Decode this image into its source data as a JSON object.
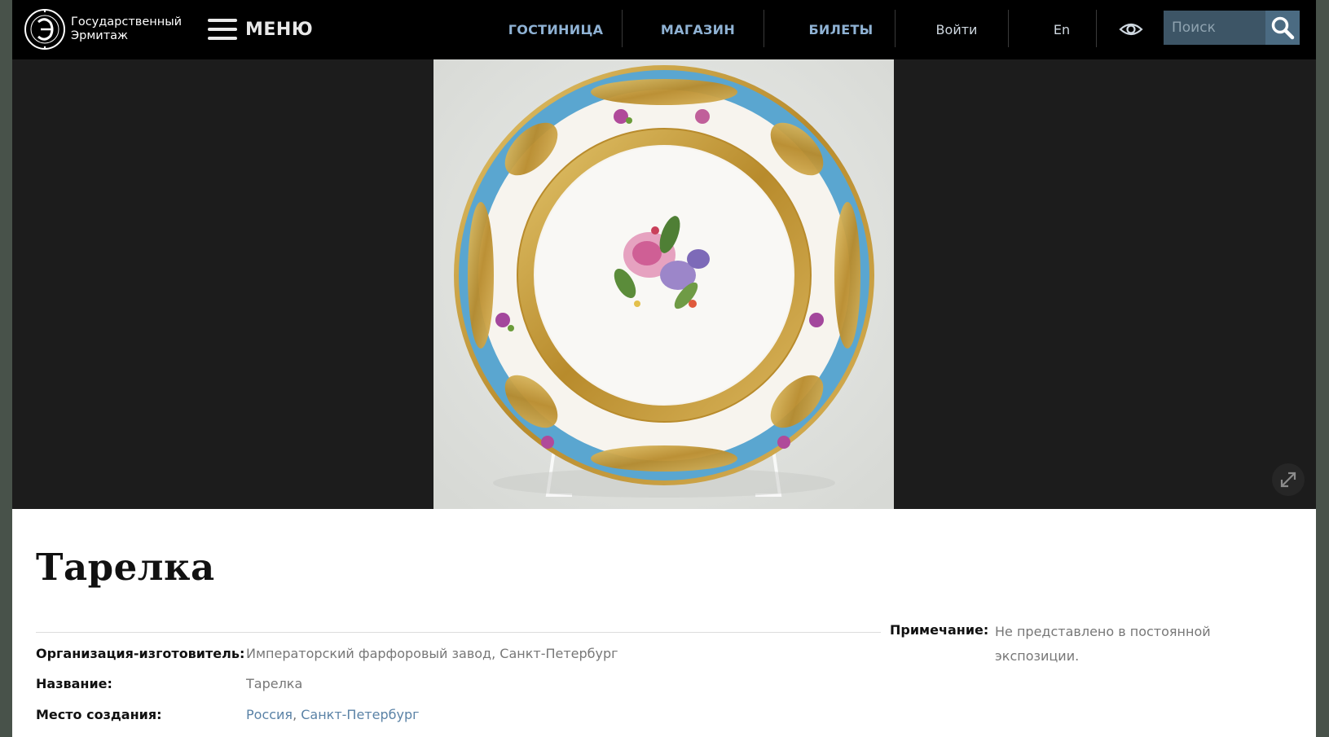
{
  "header": {
    "logo_text_line1": "Государственный",
    "logo_text_line2": "Эрмитаж",
    "menu_label": "МЕНЮ",
    "nav": [
      {
        "label": "ГОСТИНИЦА"
      },
      {
        "label": "МАГАЗИН"
      },
      {
        "label": "БИЛЕТЫ"
      },
      {
        "label": "Войти"
      },
      {
        "label": "En"
      }
    ],
    "search_placeholder": "Поиск",
    "icons": [
      "eye-icon",
      "search-icon",
      "hamburger-icon",
      "hermitage-logo-icon"
    ]
  },
  "viewer": {
    "image_subject": "porcelain plate with turquoise rim, gilt ornament and floral bouquet",
    "expand_icon": "expand-arrows-icon"
  },
  "object": {
    "title": "Тарелка",
    "attributes": [
      {
        "label": "Организация-изготовитель:",
        "value": "Императорский фарфоровый завод, Санкт-Петербург"
      },
      {
        "label": "Название:",
        "value": "Тарелка"
      },
      {
        "label": "Место создания:",
        "value_link1": "Россия",
        "value_sep": ", ",
        "value_link2": "Санкт-Петербург"
      }
    ],
    "note_label": "Примечание:",
    "note_value": "Не представлено в постоянной экспозиции."
  },
  "colors": {
    "header_bg": "#000000",
    "nav_accent": "#8fb2d4",
    "search_bg": "#3d5566",
    "viewer_bg": "#1c1c1c",
    "link": "#5a82a6",
    "plate_rim": "#5aa6d0",
    "gold": "#c9a23c"
  }
}
